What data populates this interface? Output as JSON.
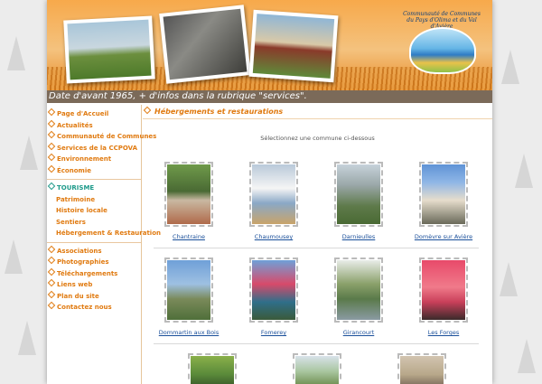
{
  "colors": {
    "accent": "#e07a10",
    "active": "#1e9a8a",
    "link": "#1a4f9a",
    "ticker_bg": "#7b6a59"
  },
  "header": {
    "logo_text": "Communauté de Communes du Pays d'Olima et du Val d'Avière",
    "ticker": "Date d'avant 1965, + d'infos dans la rubrique \"services\"."
  },
  "sidebar": {
    "items": [
      {
        "label": "Page d'Accueil"
      },
      {
        "label": "Actualités"
      },
      {
        "label": "Communauté de Communes"
      },
      {
        "label": "Services de la CCPOVA"
      },
      {
        "label": "Environnement"
      },
      {
        "label": "Économie"
      }
    ],
    "tourisme": {
      "label": "TOURISME",
      "sub": [
        {
          "label": "Patrimoine"
        },
        {
          "label": "Histoire locale"
        },
        {
          "label": "Sentiers"
        },
        {
          "label": "Hébergement & Restauration"
        }
      ]
    },
    "bottom": [
      {
        "label": "Associations"
      },
      {
        "label": "Photographies"
      },
      {
        "label": "Téléchargements"
      },
      {
        "label": "Liens web"
      },
      {
        "label": "Plan du site"
      },
      {
        "label": "Contactez nous"
      }
    ]
  },
  "main": {
    "title": "Hébergements et restaurations",
    "hint": "Sélectionnez une commune ci-dessous",
    "communes": [
      {
        "name": "Chantraine"
      },
      {
        "name": "Chaumousey"
      },
      {
        "name": "Darnieulles"
      },
      {
        "name": "Domèvre sur Avière"
      },
      {
        "name": "Dommartin aux Bois"
      },
      {
        "name": "Fomerey"
      },
      {
        "name": "Girancourt"
      },
      {
        "name": "Les Forges"
      }
    ]
  }
}
